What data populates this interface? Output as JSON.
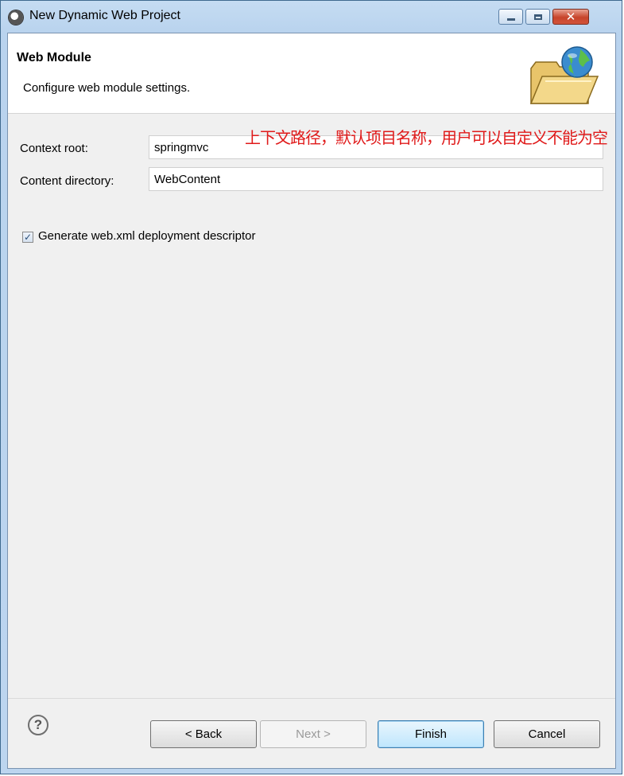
{
  "window": {
    "title": "New Dynamic Web Project",
    "buttons": {
      "minimize": "minimize",
      "maximize": "maximize",
      "close": "✕"
    }
  },
  "banner": {
    "title": "Web Module",
    "description": "Configure web module settings.",
    "icon": "web-folder-globe-icon"
  },
  "form": {
    "context_root_label": "Context root:",
    "context_root_value": "springmvc",
    "content_directory_label": "Content directory:",
    "content_directory_value": "WebContent",
    "generate_xml_label": "Generate web.xml deployment descriptor",
    "generate_xml_checked": true,
    "annotation": "上下文路径，默认项目名称，用户可以自定义不能为空"
  },
  "footer": {
    "help_symbol": "?",
    "back_label": "< Back",
    "next_label": "Next >",
    "finish_label": "Finish",
    "cancel_label": "Cancel"
  },
  "colors": {
    "annotation": "#e01a1a",
    "finish_border": "#3c7fb1"
  }
}
